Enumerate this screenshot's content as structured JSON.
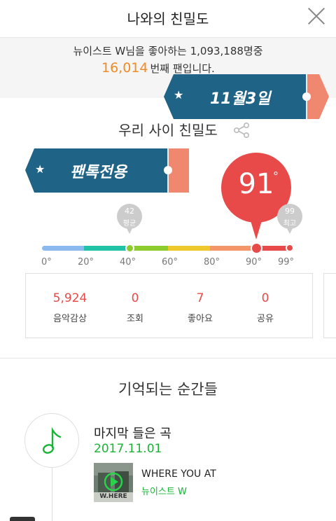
{
  "header": {
    "title": "나와의 친밀도",
    "close_icon": "close-icon"
  },
  "fan_info": {
    "line1": "뉴이스트 W님을 좋아하는 1,093,188명중",
    "rank_number": "16,014",
    "rank_suffix": "번째 팬입니다."
  },
  "date_ribbon": {
    "text": "11월3일",
    "icon": "star-icon",
    "color": "#1f6386",
    "tail_color": "#f08870"
  },
  "section": {
    "title": "우리 사이 친밀도",
    "share_icon": "share-icon"
  },
  "fantalk_ribbon": {
    "text": "팬톡전용",
    "icon": "star-icon",
    "color": "#1f6386",
    "tail_color": "#f08870"
  },
  "score": {
    "value": "91",
    "degree": "°",
    "color": "#e84a4a"
  },
  "markers": {
    "average": {
      "value": "42",
      "label": "평균"
    },
    "max": {
      "value": "99",
      "label": "최고"
    }
  },
  "scale": {
    "ticks": [
      "0°",
      "20°",
      "40°",
      "60°",
      "80°",
      "90°",
      "99°"
    ],
    "segment_colors": [
      "#8ab9ee",
      "#22c2a6",
      "#8ccc2e",
      "#edc92b",
      "#f5956a",
      "#e84a4a"
    ]
  },
  "stats": [
    {
      "value": "5,924",
      "label": "음악감상"
    },
    {
      "value": "0",
      "label": "조회"
    },
    {
      "value": "7",
      "label": "좋아요"
    },
    {
      "value": "0",
      "label": "공유"
    }
  ],
  "moments": {
    "title": "기억되는 순간들",
    "entry": {
      "icon": "music-note-icon",
      "title": "마지막 들은 곡",
      "date": "2017.11.01",
      "song_title": "WHERE YOU AT",
      "artist": "뉴이스트 W",
      "album_text": "W.HERE"
    }
  }
}
